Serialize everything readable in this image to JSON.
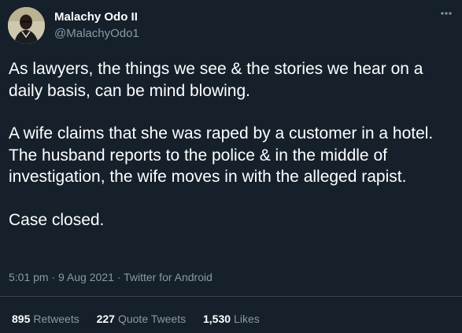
{
  "author": {
    "name": "Malachy Odo II",
    "handle": "@MalachyOdo1"
  },
  "more_icon": "more-horizontal-icon",
  "tweet": {
    "paragraphs": [
      "As lawyers, the things we see & the stories we hear on a daily basis, can be mind blowing.",
      "A wife claims that she was raped by a customer in a hotel. The husband reports to the police & in the middle of investigation, the wife moves in with the alleged rapist.",
      "Case closed."
    ]
  },
  "meta": {
    "timestamp": "5:01 pm · 9 Aug 2021 · Twitter for Android"
  },
  "stats": {
    "retweets": {
      "count": "895",
      "label": "Retweets"
    },
    "quote_tweets": {
      "count": "227",
      "label": "Quote Tweets"
    },
    "likes": {
      "count": "1,530",
      "label": "Likes"
    }
  },
  "colors": {
    "background": "#15202b",
    "primary_text": "#ffffff",
    "secondary_text": "#8899a6",
    "divider": "#38444d"
  }
}
